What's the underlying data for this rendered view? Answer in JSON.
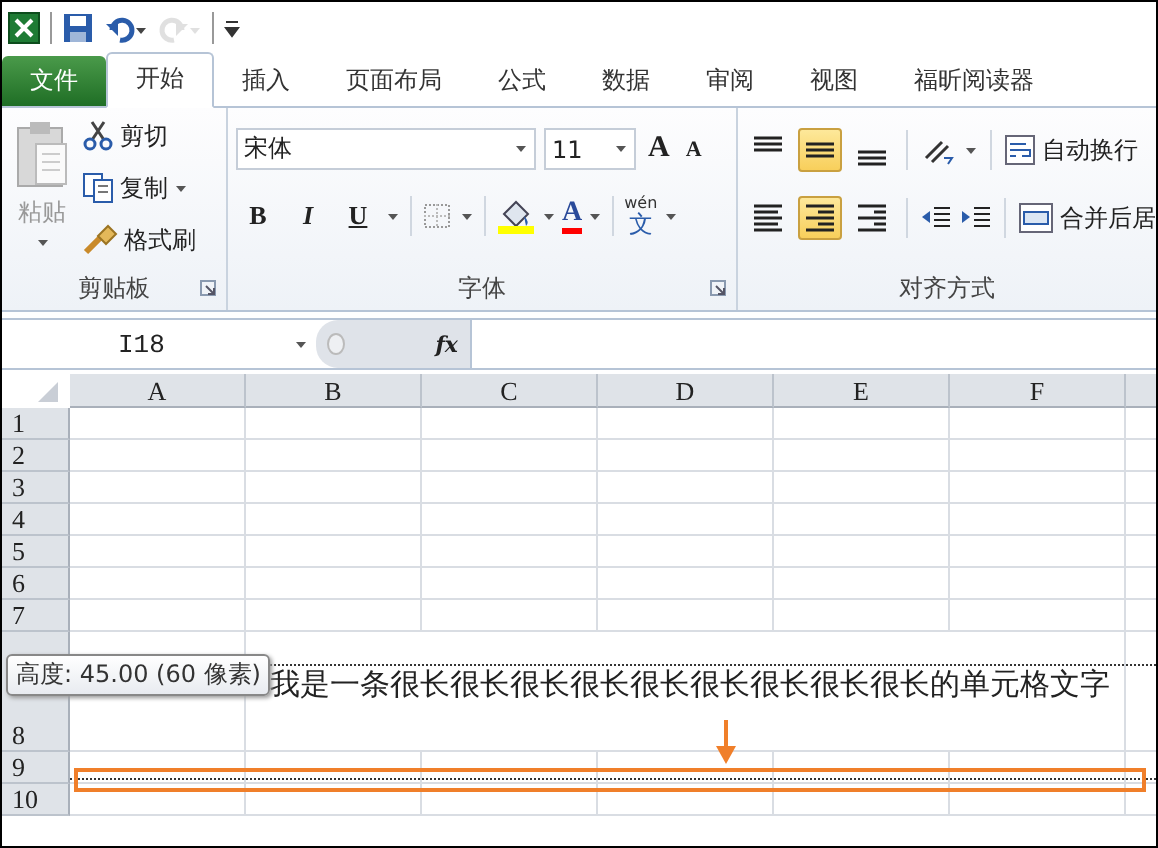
{
  "quick_access": [
    {
      "kind": "app",
      "disabled": false
    },
    {
      "kind": "save",
      "disabled": false
    },
    {
      "kind": "undo",
      "disabled": false
    },
    {
      "kind": "redo",
      "disabled": true
    },
    {
      "kind": "customize",
      "disabled": false
    }
  ],
  "tabs": [
    {
      "label": "文件",
      "kind": "file",
      "selected": false
    },
    {
      "label": "开始",
      "kind": "tab",
      "selected": true
    },
    {
      "label": "插入",
      "kind": "tab",
      "selected": false
    },
    {
      "label": "页面布局",
      "kind": "tab",
      "selected": false
    },
    {
      "label": "公式",
      "kind": "tab",
      "selected": false
    },
    {
      "label": "数据",
      "kind": "tab",
      "selected": false
    },
    {
      "label": "审阅",
      "kind": "tab",
      "selected": false
    },
    {
      "label": "视图",
      "kind": "tab",
      "selected": false
    },
    {
      "label": "福昕阅读器",
      "kind": "tab",
      "selected": false
    }
  ],
  "clipboard": {
    "label": "剪贴板",
    "launcher": true,
    "paste": "粘贴",
    "commands": [
      {
        "label": "剪切",
        "kind": "cut"
      },
      {
        "label": "复制",
        "kind": "copy",
        "dropdown": true
      },
      {
        "label": "格式刷",
        "kind": "painter"
      }
    ]
  },
  "font": {
    "label": "字体",
    "launcher": true,
    "font_name": "宋体",
    "font_size": "11",
    "grow": "A",
    "shrink": "A",
    "styles": [
      {
        "label": "B",
        "kind": "bold"
      },
      {
        "label": "I",
        "kind": "italic"
      },
      {
        "label": "U",
        "kind": "underline"
      }
    ],
    "font_color": "A",
    "phonetic_top": "wén",
    "phonetic_bottom": "文"
  },
  "alignment": {
    "label": "对齐方式",
    "vertical": [
      {
        "kind": "top",
        "selected": false
      },
      {
        "kind": "middle",
        "selected": true
      },
      {
        "kind": "bottom",
        "selected": false
      }
    ],
    "horizontal": [
      {
        "kind": "left",
        "selected": false
      },
      {
        "kind": "center",
        "selected": true
      },
      {
        "kind": "right",
        "selected": false
      }
    ],
    "wrap_text": "自动换行",
    "merge": "合并后居"
  },
  "formula_bar": {
    "name_box": "I18",
    "function_button": "fx"
  },
  "sheet": {
    "columns": [
      "A",
      "B",
      "C",
      "D",
      "E",
      "F"
    ],
    "rows": [
      {
        "header": "1"
      },
      {
        "header": "2"
      },
      {
        "header": "3"
      },
      {
        "header": "4"
      },
      {
        "header": "5"
      },
      {
        "header": "6"
      },
      {
        "header": "7"
      },
      {
        "header": "8",
        "resizing": true,
        "text": "我是一条很长很长很长很长很长很长很长很长很长的单元格文字",
        "tooltip": "高度: 45.00 (60 像素)"
      },
      {
        "header": "9"
      },
      {
        "header": "10"
      }
    ]
  }
}
